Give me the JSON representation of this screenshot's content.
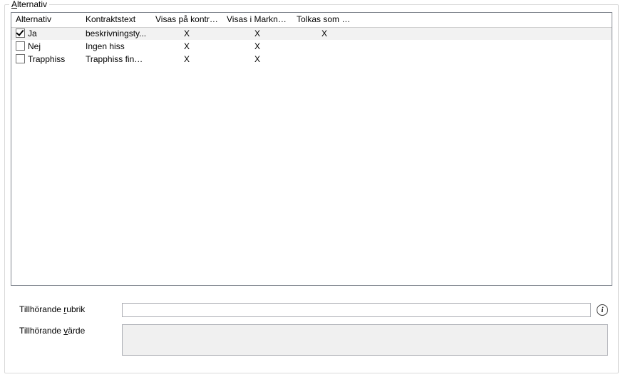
{
  "group": {
    "title_prefix": "A",
    "title_rest": "lternativ"
  },
  "columns": {
    "alt": "Alternativ",
    "ktxt": "Kontraktstext",
    "vpk": "Visas på kontrakt",
    "vim": "Visas i Markna...",
    "tsj": "Tolkas som \"Ja\""
  },
  "rows": [
    {
      "checked": true,
      "alt": "Ja",
      "ktxt": "beskrivningsty...",
      "vpk": "X",
      "vim": "X",
      "tsj": "X",
      "selected": true
    },
    {
      "checked": false,
      "alt": "Nej",
      "ktxt": "Ingen hiss",
      "vpk": "X",
      "vim": "X",
      "tsj": "",
      "selected": false
    },
    {
      "checked": false,
      "alt": "Trapphiss",
      "ktxt": "Trapphiss finns...",
      "vpk": "X",
      "vim": "X",
      "tsj": "",
      "selected": false
    }
  ],
  "form": {
    "rubrik_pre": "Tillhörande ",
    "rubrik_ul": "r",
    "rubrik_post": "ubrik",
    "rubrik_value": "",
    "varde_pre": "Tillhörande ",
    "varde_ul": "v",
    "varde_post": "ärde",
    "varde_value": ""
  },
  "info_glyph": "i"
}
